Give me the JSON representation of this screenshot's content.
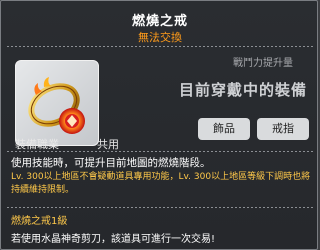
{
  "item": {
    "name": "燃燒之戒",
    "trade_status": "無法交換"
  },
  "power": {
    "label": "戰鬥力提升量",
    "status": "目前穿戴中的裝備"
  },
  "tags": [
    "飾品",
    "戒指"
  ],
  "requirements": {
    "label": "裝備職業",
    "value": "共用"
  },
  "description": "使用技能時，可提升目前地圖的燃燒階段。",
  "note": "Lv. 300以上地區不會疑動道具專用功能，Lv. 300以上地區等級下調時也將持續維持限制。",
  "level_line": "燃燒之戒1級",
  "cut_line": "若使用水晶神奇剪刀，該道具可進行一次交易!",
  "colors": {
    "title": "#ffffff",
    "trade_status": "#ff9b1a",
    "note": "#ffc94a"
  },
  "icons": {
    "item": "burning-ring-icon"
  }
}
